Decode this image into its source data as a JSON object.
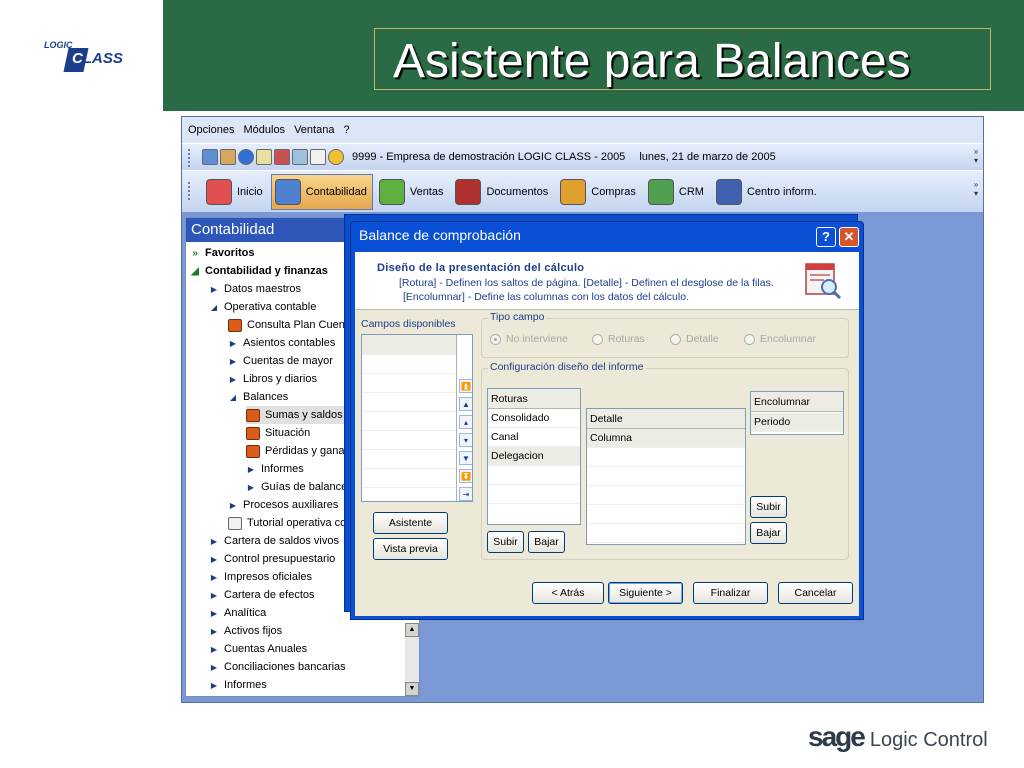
{
  "slide": {
    "title": "Asistente para Balances",
    "logo_small": "LOGIC",
    "logo_big_c": "C",
    "logo_big_rest": "LASS",
    "footer_brand": "sage",
    "footer_product": "Logic Control"
  },
  "menu": [
    "Opciones",
    "Módulos",
    "Ventana",
    "?"
  ],
  "toolbar": {
    "company": "9999 - Empresa de demostración LOGIC CLASS - 2005",
    "date": "lunes, 21 de marzo de 2005"
  },
  "modules": [
    {
      "label": "Inicio"
    },
    {
      "label": "Contabilidad"
    },
    {
      "label": "Ventas"
    },
    {
      "label": "Documentos"
    },
    {
      "label": "Compras"
    },
    {
      "label": "CRM"
    },
    {
      "label": "Centro inform."
    }
  ],
  "panel": {
    "title": "Contabilidad",
    "items": [
      {
        "label": "Favoritos"
      },
      {
        "label": "Contabilidad y finanzas"
      },
      {
        "label": "Datos maestros"
      },
      {
        "label": "Operativa contable"
      },
      {
        "label": "Consulta Plan Cuenta"
      },
      {
        "label": "Asientos contables"
      },
      {
        "label": "Cuentas de mayor"
      },
      {
        "label": "Libros y diarios"
      },
      {
        "label": "Balances"
      },
      {
        "label": "Sumas y saldos"
      },
      {
        "label": "Situación"
      },
      {
        "label": "Pérdidas y ganar"
      },
      {
        "label": "Informes"
      },
      {
        "label": "Guías de balance"
      },
      {
        "label": "Procesos auxiliares"
      },
      {
        "label": "Tutorial operativa co"
      },
      {
        "label": "Cartera de saldos vivos"
      },
      {
        "label": "Control presupuestario"
      },
      {
        "label": "Impresos oficiales"
      },
      {
        "label": "Cartera de efectos"
      },
      {
        "label": "Analítica"
      },
      {
        "label": "Activos fijos"
      },
      {
        "label": "Cuentas Anuales"
      },
      {
        "label": "Conciliaciones bancarias"
      },
      {
        "label": "Informes"
      }
    ]
  },
  "dialog": {
    "title": "Balance de comprobación",
    "help": "?",
    "close": "✕",
    "header_title": "Diseño de la presentación del cálculo",
    "header_line1": "[Rotura] - Definen los saltos de página.   [Detalle] - Definen el desglose de la filas.",
    "header_line2": "[Encolumnar] - Define las columnas con los datos del cálculo.",
    "campos_label": "Campos disponibles",
    "tipo_campo": "Tipo campo",
    "radios": [
      "No interviene",
      "Roturas",
      "Detalle",
      "Encolumnar"
    ],
    "config_label": "Configuración diseño del informe",
    "roturas": {
      "header": "Roturas",
      "rows": [
        "Consolidado",
        "Canal",
        "Delegacion"
      ]
    },
    "detalle": {
      "header": "Detalle",
      "rows": [
        "Columna"
      ]
    },
    "encolumnar": {
      "rows": [
        "Encolumnar",
        "Periodo"
      ]
    },
    "buttons": {
      "asistente": "Asistente",
      "vista_previa": "Vista previa",
      "subir": "Subir",
      "bajar": "Bajar",
      "subir2": "Subir",
      "bajar2": "Bajar",
      "atras": "< Atrás",
      "siguiente": "Siguiente >",
      "finalizar": "Finalizar",
      "cancelar": "Cancelar"
    }
  }
}
